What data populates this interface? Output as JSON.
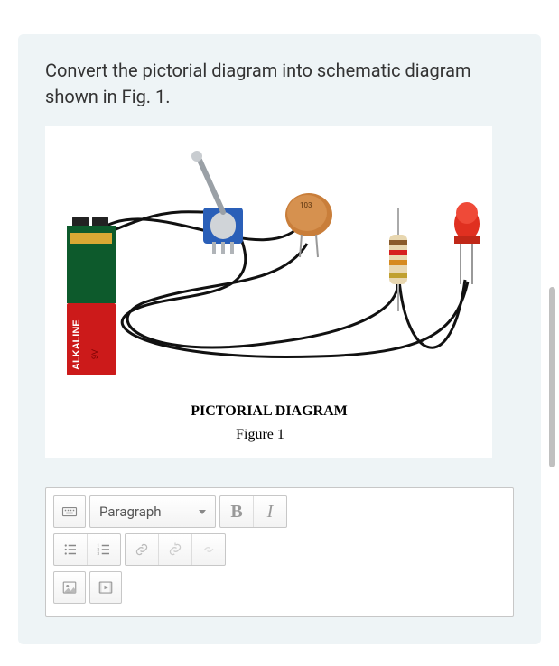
{
  "question": {
    "text": "Convert the pictorial diagram into schematic diagram shown in Fig. 1."
  },
  "figure": {
    "battery_label": "ALKALINE",
    "battery_voltage": "9V",
    "capacitor_label": "103",
    "caption_title": "PICTORIAL DIAGRAM",
    "caption_sub": "Figure 1"
  },
  "editor": {
    "format_select": "Paragraph",
    "bold_label": "B",
    "italic_label": "I"
  }
}
